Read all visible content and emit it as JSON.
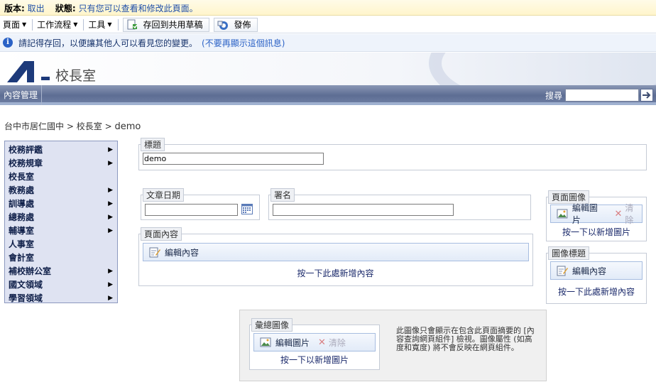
{
  "status": {
    "version_label": "版本:",
    "version_value": "取出",
    "state_label": "狀態:",
    "state_value": "只有您可以查看和修改此頁面。"
  },
  "toolbar": {
    "page_menu": "頁面",
    "workflow_menu": "工作流程",
    "tools_menu": "工具",
    "save_draft": "存回到共用草稿",
    "publish": "發佈"
  },
  "info": {
    "message": "請記得存回，以便讓其他人可以看見您的變更。",
    "dismiss": "(不要再顯示這個訊息)"
  },
  "site": {
    "title": "校長室"
  },
  "nav": {
    "tab": "內容管理",
    "search_label": "搜尋"
  },
  "breadcrumb": {
    "parts": [
      "台中市居仁國中",
      "校長室"
    ],
    "sep": ">",
    "current": "demo"
  },
  "left_nav": {
    "items": [
      {
        "label": "校務評鑑",
        "arrow": "▶"
      },
      {
        "label": "校務規章",
        "arrow": "▶"
      },
      {
        "label": "校長室",
        "arrow": ""
      },
      {
        "label": "教務處",
        "arrow": "▶"
      },
      {
        "label": "訓導處",
        "arrow": "▶"
      },
      {
        "label": "總務處",
        "arrow": "▶"
      },
      {
        "label": "輔導室",
        "arrow": "▶"
      },
      {
        "label": "人事室",
        "arrow": ""
      },
      {
        "label": "會計室",
        "arrow": ""
      },
      {
        "label": "補校辦公室",
        "arrow": "▶"
      },
      {
        "label": "國文領域",
        "arrow": "▶"
      },
      {
        "label": "學習領域",
        "arrow": "▶"
      }
    ]
  },
  "form": {
    "title_legend": "標題",
    "title_value": "demo",
    "date_legend": "文章日期",
    "date_value": "",
    "byline_legend": "署名",
    "byline_value": "",
    "content_legend": "頁面內容",
    "edit_content": "編輯內容",
    "add_content": "按一下此處新增內容",
    "page_image_legend": "頁面圖像",
    "edit_image": "編輯圖片",
    "clear": "清除",
    "add_image": "按一下以新增圖片",
    "caption_legend": "圖像標題",
    "rollup_legend": "彙總圖像",
    "rollup_note": "此圖像只會顯示在包含此頁面摘要的 [內容查詢網頁組件] 檢視。圖像屬性 (如高度和寬度) 將不會反映在網頁組件。"
  }
}
